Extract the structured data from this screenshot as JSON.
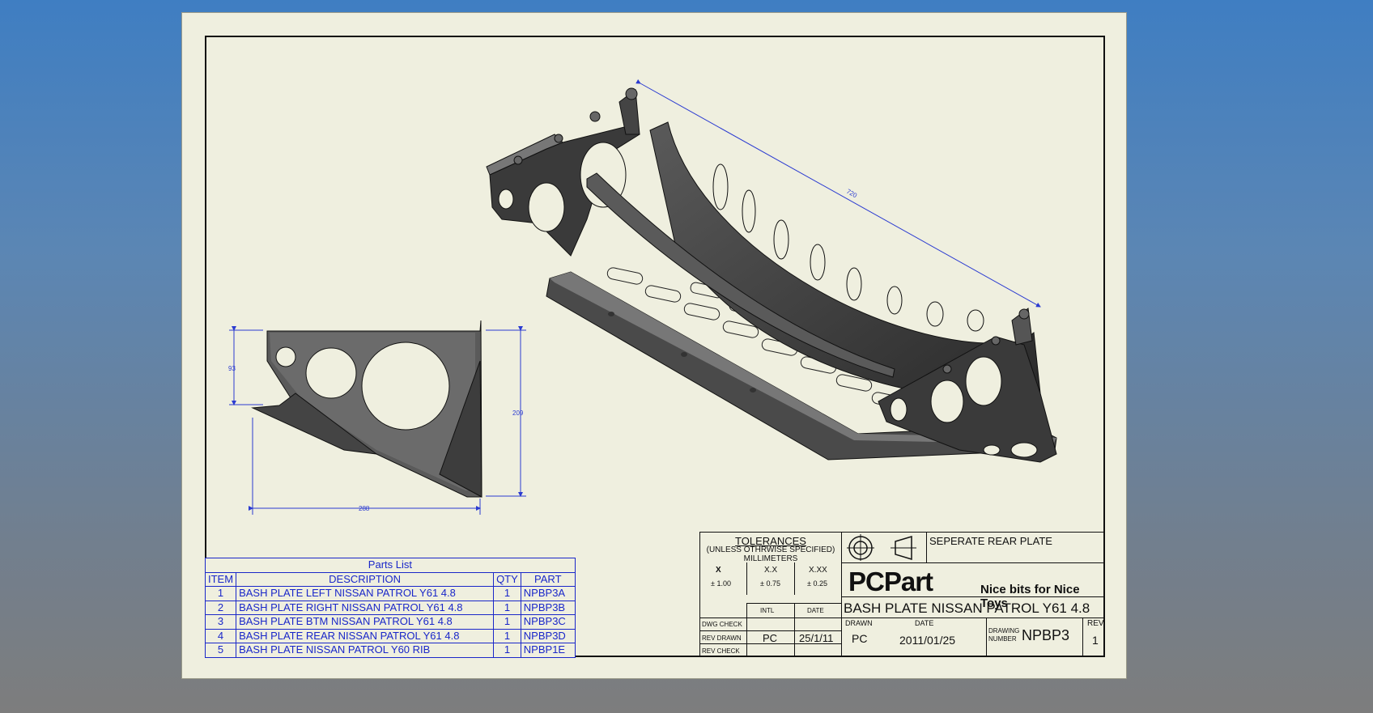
{
  "drawing": {
    "dimensions": {
      "length": "720",
      "height_small": "93",
      "height_side": "209",
      "width_side": "288"
    }
  },
  "parts_list": {
    "title": "Parts List",
    "headers": [
      "ITEM",
      "DESCRIPTION",
      "QTY",
      "PART"
    ],
    "rows": [
      {
        "item": "1",
        "description": "BASH PLATE LEFT NISSAN PATROL Y61 4.8",
        "qty": "1",
        "part": "NPBP3A"
      },
      {
        "item": "2",
        "description": "BASH PLATE RIGHT NISSAN PATROL Y61 4.8",
        "qty": "1",
        "part": "NPBP3B"
      },
      {
        "item": "3",
        "description": "BASH PLATE BTM NISSAN PATROL Y61 4.8",
        "qty": "1",
        "part": "NPBP3C"
      },
      {
        "item": "4",
        "description": "BASH PLATE REAR NISSAN PATROL Y61 4.8",
        "qty": "1",
        "part": "NPBP3D"
      },
      {
        "item": "5",
        "description": "BASH PLATE NISSAN PATROL Y60 RIB",
        "qty": "1",
        "part": "NPBP1E"
      }
    ]
  },
  "title_block": {
    "tolerances": {
      "heading": "TOLERANCES",
      "line1": "(UNLESS OTHRWISE SPECIFIED)",
      "line2": "MILLIMETERS",
      "x_label": "X",
      "x_value": "± 1.00",
      "xx_label": "X.X",
      "xx_value": "± 0.75",
      "xxx_label": "X.XX",
      "xxx_value": "± 0.25"
    },
    "checks": {
      "intl_header": "INTL",
      "date_header": "DATE",
      "dwg_check": "DWG CHECK",
      "rev_drawn": "REV DRAWN",
      "rev_drawn_intl": "PC",
      "rev_drawn_date": "25/1/11",
      "rev_check": "REV CHECK"
    },
    "note": "SEPERATE REAR PLATE",
    "company": "PCPart",
    "slogan": "Nice bits for Nice Toys",
    "drawing_title": "BASH PLATE NISSAN PATROL Y61 4.8",
    "drawn_label": "DRAWN",
    "drawn_by": "PC",
    "date_label": "DATE",
    "date": "2011/01/25",
    "drawing_number_label_1": "DRAWING",
    "drawing_number_label_2": "NUMBER",
    "drawing_number": "NPBP3",
    "rev_label": "REV",
    "rev": "1"
  }
}
